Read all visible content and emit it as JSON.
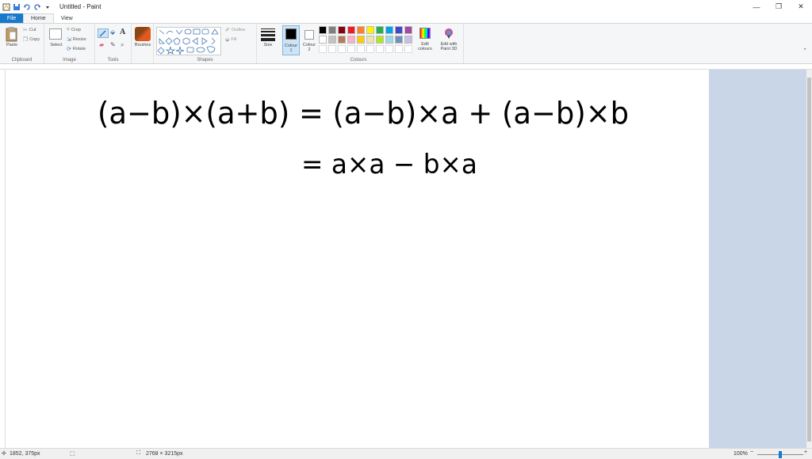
{
  "window": {
    "title": "Untitled - Paint"
  },
  "tabs": [
    {
      "label": "File"
    },
    {
      "label": "Home"
    },
    {
      "label": "View"
    }
  ],
  "ribbon": {
    "clipboard": {
      "paste": "Paste",
      "cut": "Cut",
      "copy": "Copy",
      "group": "Clipboard"
    },
    "image": {
      "select": "Select",
      "crop": "Crop",
      "resize": "Resize",
      "rotate": "Rotate",
      "group": "Image"
    },
    "tools": {
      "group": "Tools"
    },
    "brushes": {
      "label": "Brushes"
    },
    "shapes": {
      "outline": "Outline",
      "fill": "Fill",
      "group": "Shapes"
    },
    "size": {
      "label": "Size"
    },
    "colour1": {
      "label": "Colour 1"
    },
    "colour2": {
      "label": "Colour 2"
    },
    "colours": {
      "group": "Colours",
      "edit": "Edit colours",
      "paint3d": "Edit with Paint 3D"
    }
  },
  "palette": [
    "#000000",
    "#7f7f7f",
    "#880015",
    "#ed1c24",
    "#ff7f27",
    "#fff200",
    "#22b14c",
    "#00a2e8",
    "#3f48cc",
    "#a349a4",
    "#ffffff",
    "#c3c3c3",
    "#b97a57",
    "#ffaec9",
    "#ffc90e",
    "#efe4b0",
    "#b5e61d",
    "#99d9ea",
    "#7092be",
    "#c8bfe7"
  ],
  "canvas": {
    "line1": "(a−b)×(a+b) = (a−b)×a + (a−b)×b",
    "line2": "= a×a − b×a"
  },
  "status": {
    "cursor": "1852, 375px",
    "dimensions": "2768 × 3215px",
    "zoom": "100%"
  }
}
